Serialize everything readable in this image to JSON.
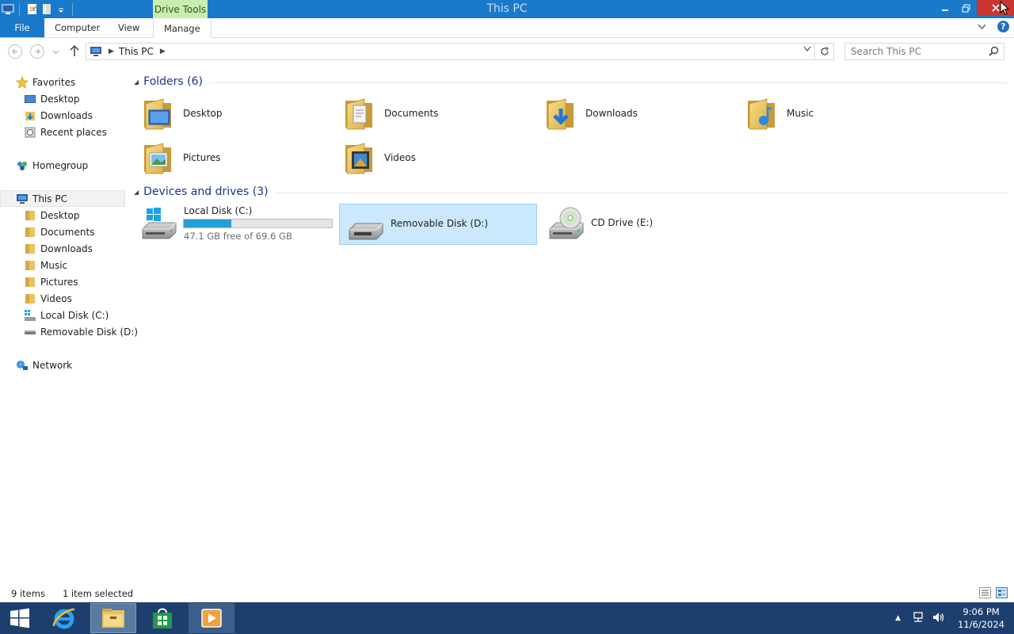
{
  "window": {
    "title": "This PC",
    "context_tab": "Drive Tools"
  },
  "ribbon": {
    "tabs": [
      {
        "label": "File"
      },
      {
        "label": "Computer"
      },
      {
        "label": "View"
      },
      {
        "label": "Manage"
      }
    ],
    "help_label": "?"
  },
  "address": {
    "path": "This PC",
    "search_placeholder": "Search This PC"
  },
  "nav": {
    "favorites": {
      "label": "Favorites",
      "items": [
        "Desktop",
        "Downloads",
        "Recent places"
      ]
    },
    "homegroup": {
      "label": "Homegroup"
    },
    "this_pc": {
      "label": "This PC",
      "items": [
        "Desktop",
        "Documents",
        "Downloads",
        "Music",
        "Pictures",
        "Videos",
        "Local Disk (C:)",
        "Removable Disk (D:)"
      ]
    },
    "network": {
      "label": "Network"
    }
  },
  "folders": {
    "header": "Folders (6)",
    "items": [
      "Desktop",
      "Documents",
      "Downloads",
      "Music",
      "Pictures",
      "Videos"
    ]
  },
  "devices": {
    "header": "Devices and drives (3)",
    "items": [
      {
        "name": "Local Disk (C:)",
        "free_text": "47.1 GB free of 69.6 GB",
        "used_fraction": 0.323
      },
      {
        "name": "Removable Disk (D:)",
        "selected": true
      },
      {
        "name": "CD Drive (E:)"
      }
    ]
  },
  "status": {
    "items_count": "9 items",
    "selection": "1 item selected"
  },
  "taskbar": {
    "time": "9:06 PM",
    "date": "11/6/2024"
  },
  "colors": {
    "accent": "#1979ca",
    "drive_tools": "#c9ecb0",
    "selection": "#cce8ff",
    "bar_fill": "#26a0da",
    "taskbar": "#1d3f6e"
  }
}
